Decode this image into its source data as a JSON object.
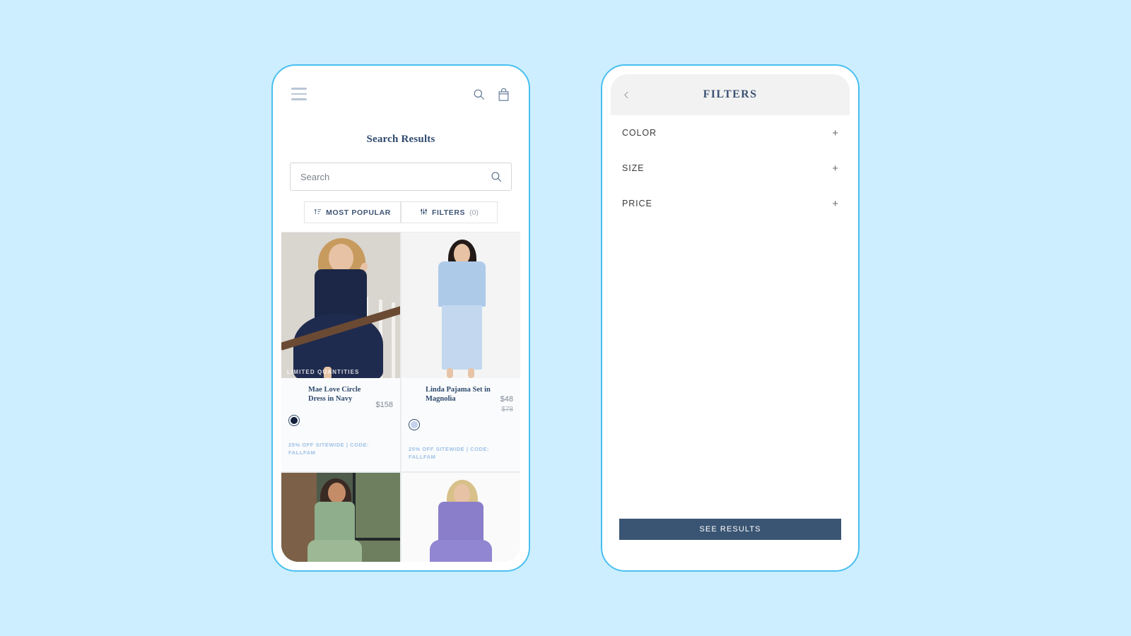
{
  "background_color": "#cdeeff",
  "frame_color": "#49c0f0",
  "left_phone": {
    "appbar": {
      "menu_icon": "hamburger-icon",
      "search_icon": "search-icon",
      "cart_icon": "shopping-bag-icon"
    },
    "page_title": "Search Results",
    "search": {
      "placeholder": "Search",
      "value": "",
      "icon": "search-icon"
    },
    "toolbar": {
      "sort_label": "MOST POPULAR",
      "sort_icon": "sort-ascending-icon",
      "filters_label": "FILTERS",
      "filters_count": "(0)",
      "filters_icon": "sliders-icon"
    },
    "products": [
      {
        "name": "Mae Love Circle Dress in Navy",
        "price": "$158",
        "price_old": "",
        "badge": "LIMITED QUANTITIES",
        "promo": "25% OFF SITEWIDE | CODE: FALLFAM",
        "swatch_color": "#13213d",
        "swatch_name": "navy-swatch"
      },
      {
        "name": "Linda Pajama Set in Magnolia",
        "price": "$48",
        "price_old": "$78",
        "badge": "",
        "promo": "25% OFF SITEWIDE | CODE: FALLFAM",
        "swatch_color": "#c4d2ee",
        "swatch_name": "magnolia-swatch"
      },
      {
        "name": "",
        "price": "",
        "price_old": "",
        "badge": "",
        "promo": "",
        "swatch_color": "",
        "swatch_name": ""
      },
      {
        "name": "",
        "price": "",
        "price_old": "",
        "badge": "",
        "promo": "",
        "swatch_color": "",
        "swatch_name": ""
      }
    ]
  },
  "right_phone": {
    "header": {
      "back_icon": "chevron-left-icon",
      "title": "FILTERS"
    },
    "filters": [
      {
        "label": "COLOR",
        "expand": "+"
      },
      {
        "label": "SIZE",
        "expand": "+"
      },
      {
        "label": "PRICE",
        "expand": "+"
      }
    ],
    "see_results_label": "SEE RESULTS",
    "see_results_color": "#3a5573"
  }
}
